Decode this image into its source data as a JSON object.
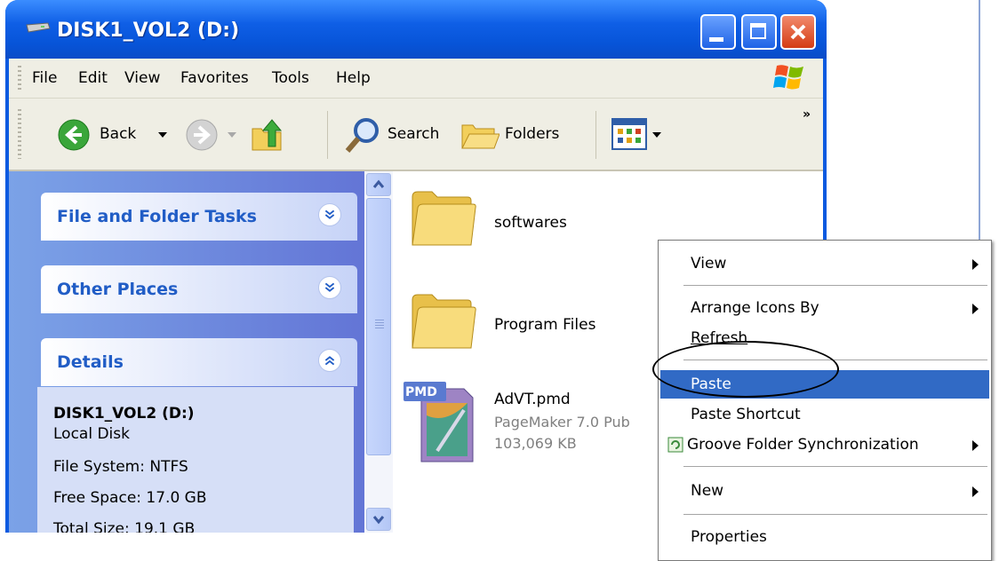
{
  "window": {
    "title": "DISK1_VOL2 (D:)"
  },
  "menu": [
    "File",
    "Edit",
    "View",
    "Favorites",
    "Tools",
    "Help"
  ],
  "toolbar": {
    "back": "Back",
    "search": "Search",
    "folders": "Folders",
    "more": "»"
  },
  "panels": {
    "file_tasks": "File and Folder Tasks",
    "other_places": "Other Places",
    "details": "Details"
  },
  "details": {
    "name": "DISK1_VOL2 (D:)",
    "type": "Local Disk",
    "fs": "File System: NTFS",
    "free": "Free Space: 17.0 GB",
    "total_cut": "Total Size: 19.1 GB"
  },
  "files": [
    {
      "name": "softwares"
    },
    {
      "name": "Program Files"
    },
    {
      "name": "AdVT.pmd",
      "type": "PageMaker 7.0 Pub",
      "size": "103,069 KB",
      "badge": "PMD"
    }
  ],
  "context_menu": {
    "view": "View",
    "arrange": "Arrange Icons By",
    "refresh": "Refresh",
    "paste": "Paste",
    "paste_shortcut": "Paste Shortcut",
    "groove": "Groove Folder Synchronization",
    "new": "New",
    "properties": "Properties"
  },
  "colors": {
    "title_blue": "#0a5ae0",
    "highlight": "#316ac5",
    "task_link": "#215dc6"
  }
}
